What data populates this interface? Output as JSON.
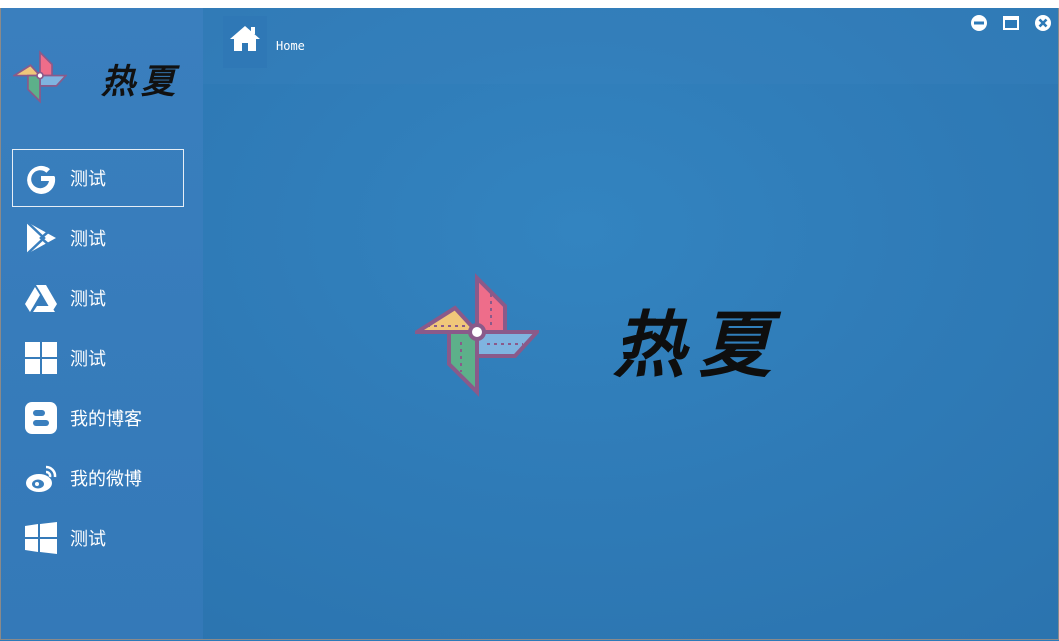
{
  "app": {
    "title": "热夏",
    "center_title": "热夏"
  },
  "header": {
    "breadcrumb": "Home"
  },
  "sidebar": {
    "items": [
      {
        "label": "测试",
        "icon": "google-icon",
        "active": true
      },
      {
        "label": "测试",
        "icon": "play-store-icon",
        "active": false
      },
      {
        "label": "测试",
        "icon": "google-drive-icon",
        "active": false
      },
      {
        "label": "测试",
        "icon": "windows-tiles-icon",
        "active": false
      },
      {
        "label": "我的博客",
        "icon": "blogger-icon",
        "active": false
      },
      {
        "label": "我的微博",
        "icon": "weibo-icon",
        "active": false
      },
      {
        "label": "测试",
        "icon": "windows-icon",
        "active": false
      }
    ]
  },
  "window_controls": [
    "minimize-icon",
    "maximize-icon",
    "close-icon"
  ],
  "colors": {
    "background": "#2d7ab8",
    "sidebar": "#3a7fbe",
    "text": "#ffffff",
    "active_border": "#e6eef6"
  }
}
